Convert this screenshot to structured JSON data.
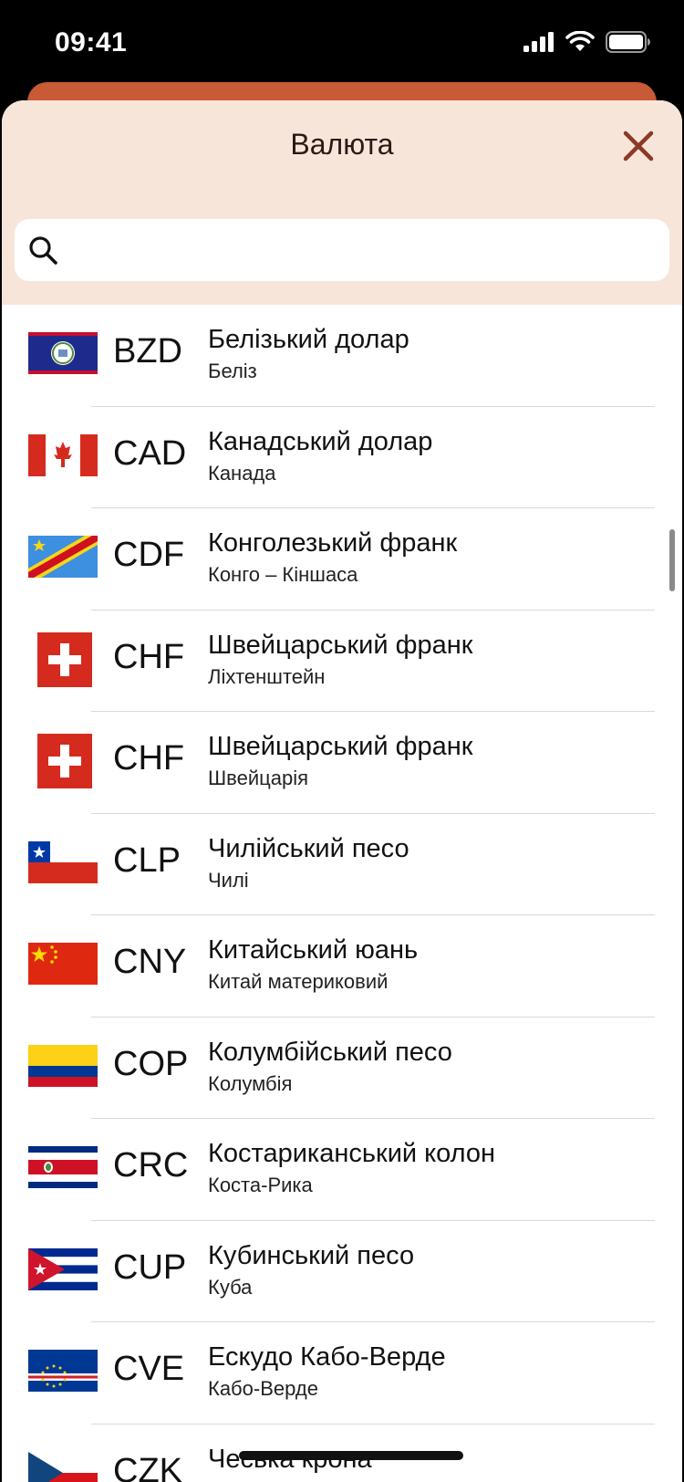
{
  "status_bar": {
    "time": "09:41",
    "signal_icon": "cellular-signal-icon",
    "wifi_icon": "wifi-icon",
    "battery_icon": "battery-icon"
  },
  "sheet": {
    "title": "Валюта",
    "close_icon": "close-icon",
    "search": {
      "placeholder": "",
      "value": "",
      "icon": "search-icon"
    }
  },
  "colors": {
    "header_bg": "#f8e5da",
    "accent": "#8b3a28",
    "behind_bar": "#c85a35"
  },
  "currencies": [
    {
      "code": "BZD",
      "name": "Белізький долар",
      "country": "Беліз",
      "flag": "belize-flag"
    },
    {
      "code": "CAD",
      "name": "Канадський долар",
      "country": "Канада",
      "flag": "canada-flag"
    },
    {
      "code": "CDF",
      "name": "Конголезький франк",
      "country": "Конго – Кіншаса",
      "flag": "dr-congo-flag"
    },
    {
      "code": "CHF",
      "name": "Швейцарський франк",
      "country": "Ліхтенштейн",
      "flag": "swiss-flag"
    },
    {
      "code": "CHF",
      "name": "Швейцарський франк",
      "country": "Швейцарія",
      "flag": "swiss-flag"
    },
    {
      "code": "CLP",
      "name": "Чилійський песо",
      "country": "Чилі",
      "flag": "chile-flag"
    },
    {
      "code": "CNY",
      "name": "Китайський юань",
      "country": "Китай материковий",
      "flag": "china-flag"
    },
    {
      "code": "COP",
      "name": "Колумбійський песо",
      "country": "Колумбія",
      "flag": "colombia-flag"
    },
    {
      "code": "CRC",
      "name": "Костариканський колон",
      "country": "Коста-Рика",
      "flag": "costa-rica-flag"
    },
    {
      "code": "CUP",
      "name": "Кубинський песо",
      "country": "Куба",
      "flag": "cuba-flag"
    },
    {
      "code": "CVE",
      "name": "Ескудо Кабо-Верде",
      "country": "Кабо-Верде",
      "flag": "cape-verde-flag"
    },
    {
      "code": "CZK",
      "name": "Чеська крона",
      "country": "",
      "flag": "czech-flag"
    }
  ]
}
